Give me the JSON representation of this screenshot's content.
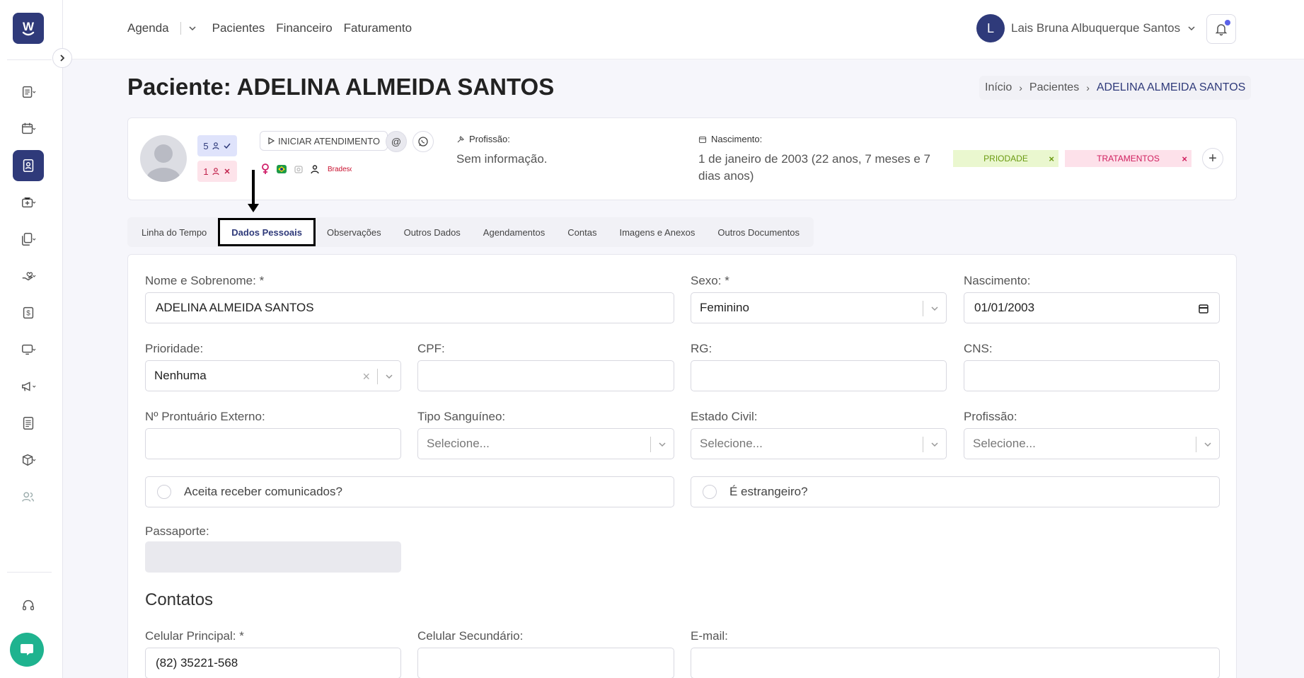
{
  "topnav": {
    "agenda": "Agenda",
    "pacientes": "Pacientes",
    "financeiro": "Financeiro",
    "faturamento": "Faturamento"
  },
  "user": {
    "initial": "L",
    "name": "Lais Bruna Albuquerque Santos"
  },
  "page": {
    "title": "Paciente: ADELINA ALMEIDA SANTOS"
  },
  "breadcrumb": {
    "home": "Início",
    "section": "Pacientes",
    "current": "ADELINA ALMEIDA SANTOS"
  },
  "patient": {
    "badge_ok": "5",
    "badge_no": "1",
    "start_button": "INICIAR ATENDIMENTO",
    "insurance_label": "Bradesco",
    "profession_label": "Profissão:",
    "profession_value": "Sem informação.",
    "birth_label": "Nascimento:",
    "birth_value": "1 de janeiro de 2003 (22 anos, 7 meses e 7 dias anos)",
    "tags": [
      "PRIODADE",
      "TRATAMENTOS"
    ]
  },
  "tabs": [
    "Linha do Tempo",
    "Dados Pessoais",
    "Observações",
    "Outros Dados",
    "Agendamentos",
    "Contas",
    "Imagens e Anexos",
    "Outros Documentos"
  ],
  "form": {
    "nome_label": "Nome e Sobrenome: *",
    "nome_value": "ADELINA ALMEIDA SANTOS",
    "sexo_label": "Sexo: *",
    "sexo_value": "Feminino",
    "nasc_label": "Nascimento:",
    "nasc_value": "01/01/2003",
    "prioridade_label": "Prioridade:",
    "prioridade_value": "Nenhuma",
    "cpf_label": "CPF:",
    "rg_label": "RG:",
    "cns_label": "CNS:",
    "prontuario_label": "Nº Prontuário Externo:",
    "sangue_label": "Tipo Sanguíneo:",
    "civil_label": "Estado Civil:",
    "profissao_label": "Profissão:",
    "select_placeholder": "Selecione...",
    "comunicados_label": "Aceita receber comunicados?",
    "estrangeiro_label": "É estrangeiro?",
    "passaporte_label": "Passaporte:",
    "contatos_title": "Contatos",
    "cel_principal_label": "Celular Principal: *",
    "cel_principal_value": "(82) 35221-568",
    "cel_secundario_label": "Celular Secundário:",
    "email_label": "E-mail:"
  },
  "colors": {
    "brand": "#2f3a7a",
    "chat": "#1fb38f",
    "tag_prio_bg": "#eaf7cf",
    "tag_trat_bg": "#fde1ea"
  }
}
